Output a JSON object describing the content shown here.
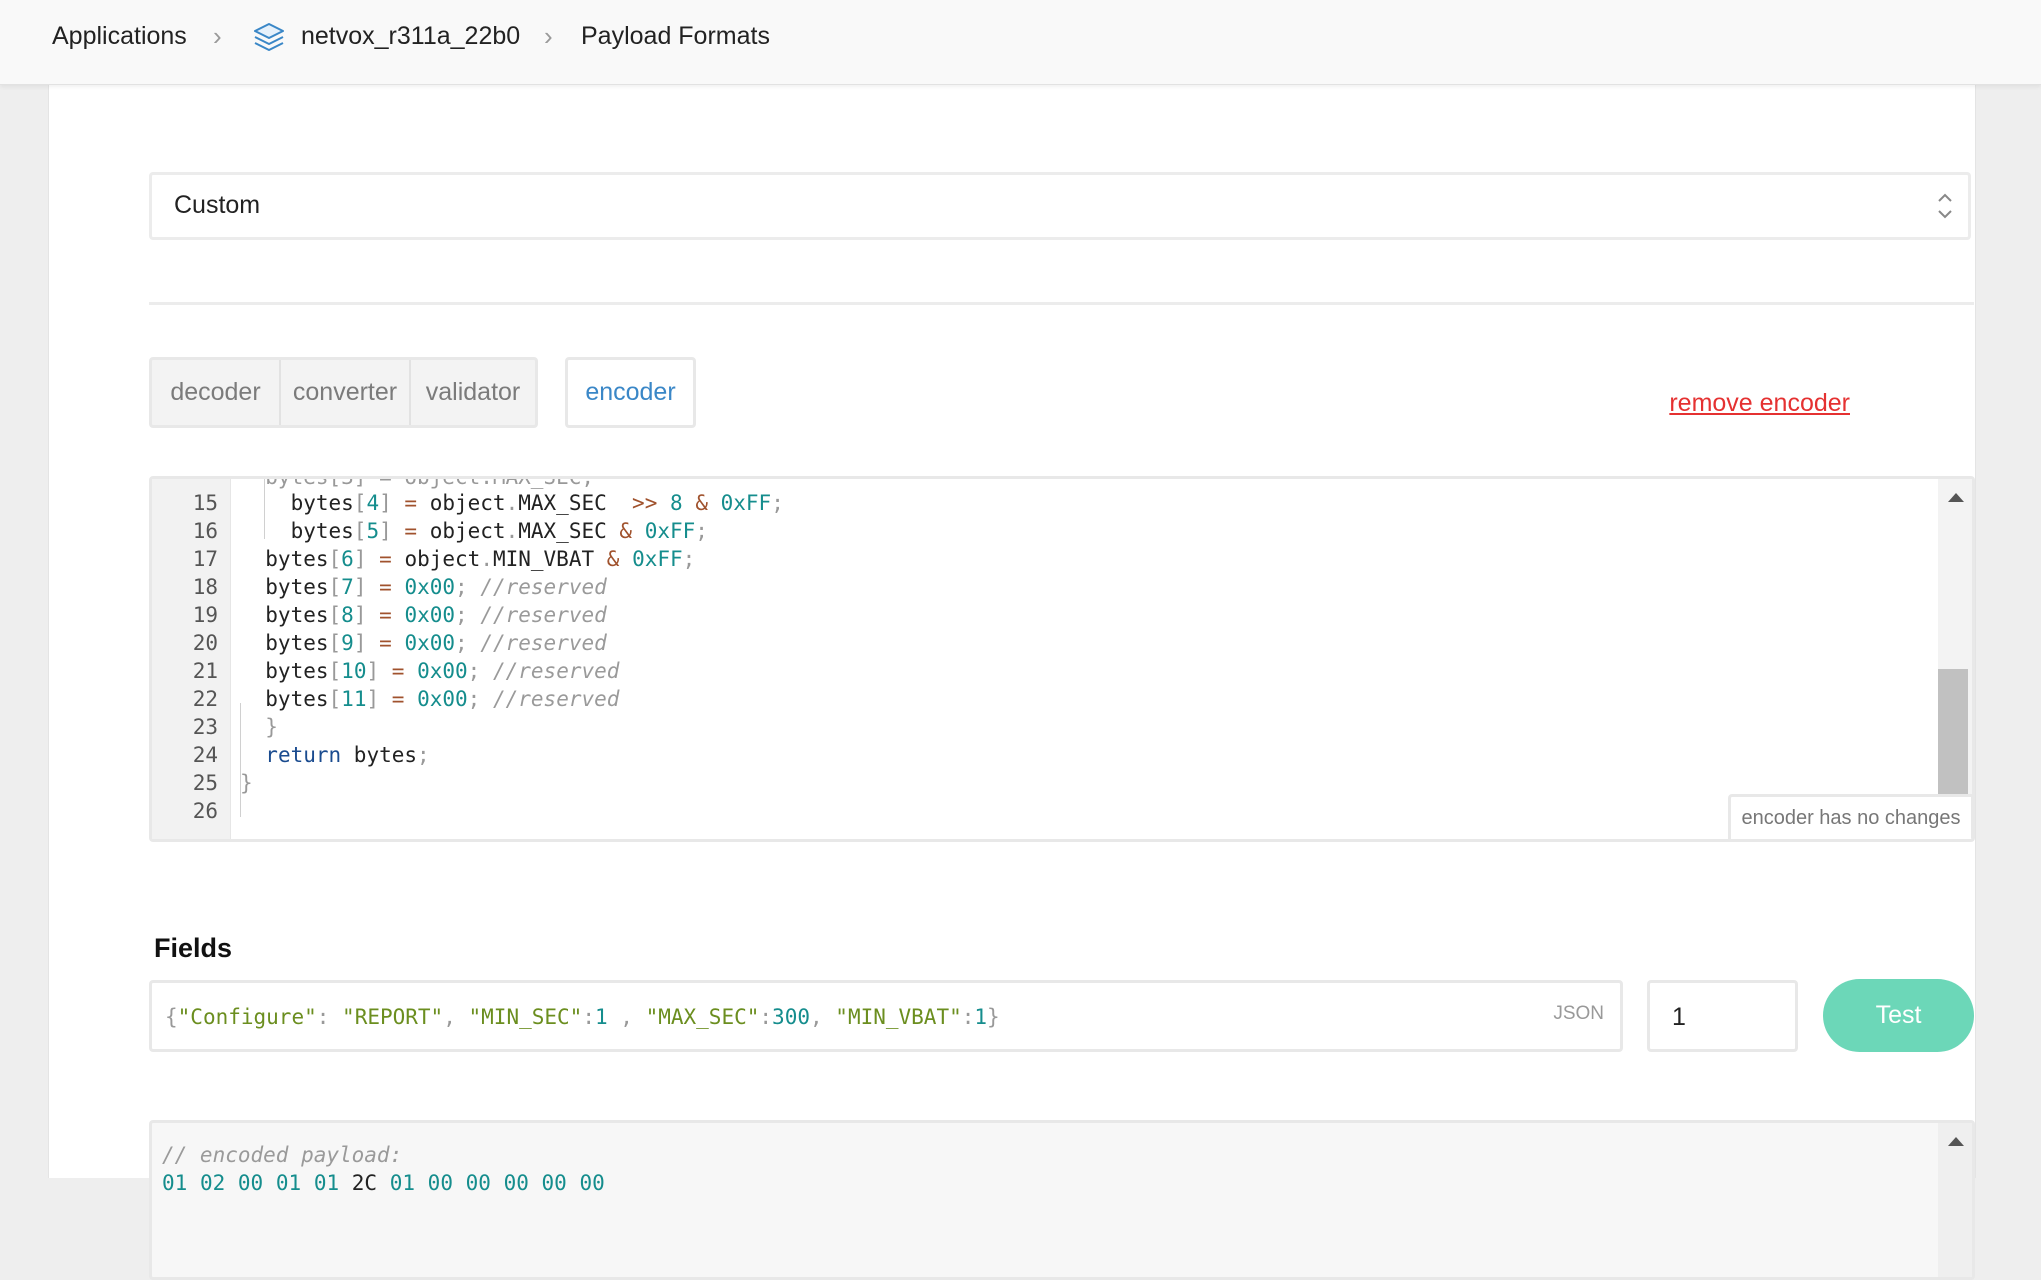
{
  "breadcrumb": {
    "applications": "Applications",
    "sep1": "›",
    "app_name": "netvox_r311a_22b0",
    "sep2": "›",
    "page": "Payload Formats"
  },
  "format_select": {
    "value": "Custom"
  },
  "tabs": {
    "decoder": "decoder",
    "converter": "converter",
    "validator": "validator",
    "encoder": "encoder"
  },
  "remove_encoder": "remove encoder",
  "editor": {
    "lines": [
      {
        "n": "15",
        "code": "    bytes[4] = object.MAX_SEC  >> 8 & 0xFF;"
      },
      {
        "n": "16",
        "code": "    bytes[5] = object.MAX_SEC & 0xFF;"
      },
      {
        "n": "17",
        "code": "  bytes[6] = object.MIN_VBAT & 0xFF;"
      },
      {
        "n": "18",
        "code": "  bytes[7] = 0x00; //reserved"
      },
      {
        "n": "19",
        "code": "  bytes[8] = 0x00; //reserved"
      },
      {
        "n": "20",
        "code": "  bytes[9] = 0x00; //reserved"
      },
      {
        "n": "21",
        "code": "  bytes[10] = 0x00; //reserved"
      },
      {
        "n": "22",
        "code": "  bytes[11] = 0x00; //reserved"
      },
      {
        "n": "23",
        "code": "  }"
      },
      {
        "n": "24",
        "code": "  return bytes;"
      },
      {
        "n": "25",
        "code": "}"
      },
      {
        "n": "26",
        "code": ""
      }
    ],
    "status": "encoder has no changes"
  },
  "fields": {
    "title": "Fields",
    "json_value": "{\"Configure\": \"REPORT\", \"MIN_SEC\":1 , \"MAX_SEC\":300, \"MIN_VBAT\":1}",
    "json_tag": "JSON",
    "port_value": "1",
    "test_label": "Test"
  },
  "output": {
    "comment": "// encoded payload:",
    "bytes": [
      "01",
      "02",
      "00",
      "01",
      "01",
      "2C",
      "01",
      "00",
      "00",
      "00",
      "00",
      "00"
    ]
  },
  "colors": {
    "accent_blue": "#3a87c7",
    "danger_red": "#e53131",
    "test_green": "#6cd7b8"
  }
}
